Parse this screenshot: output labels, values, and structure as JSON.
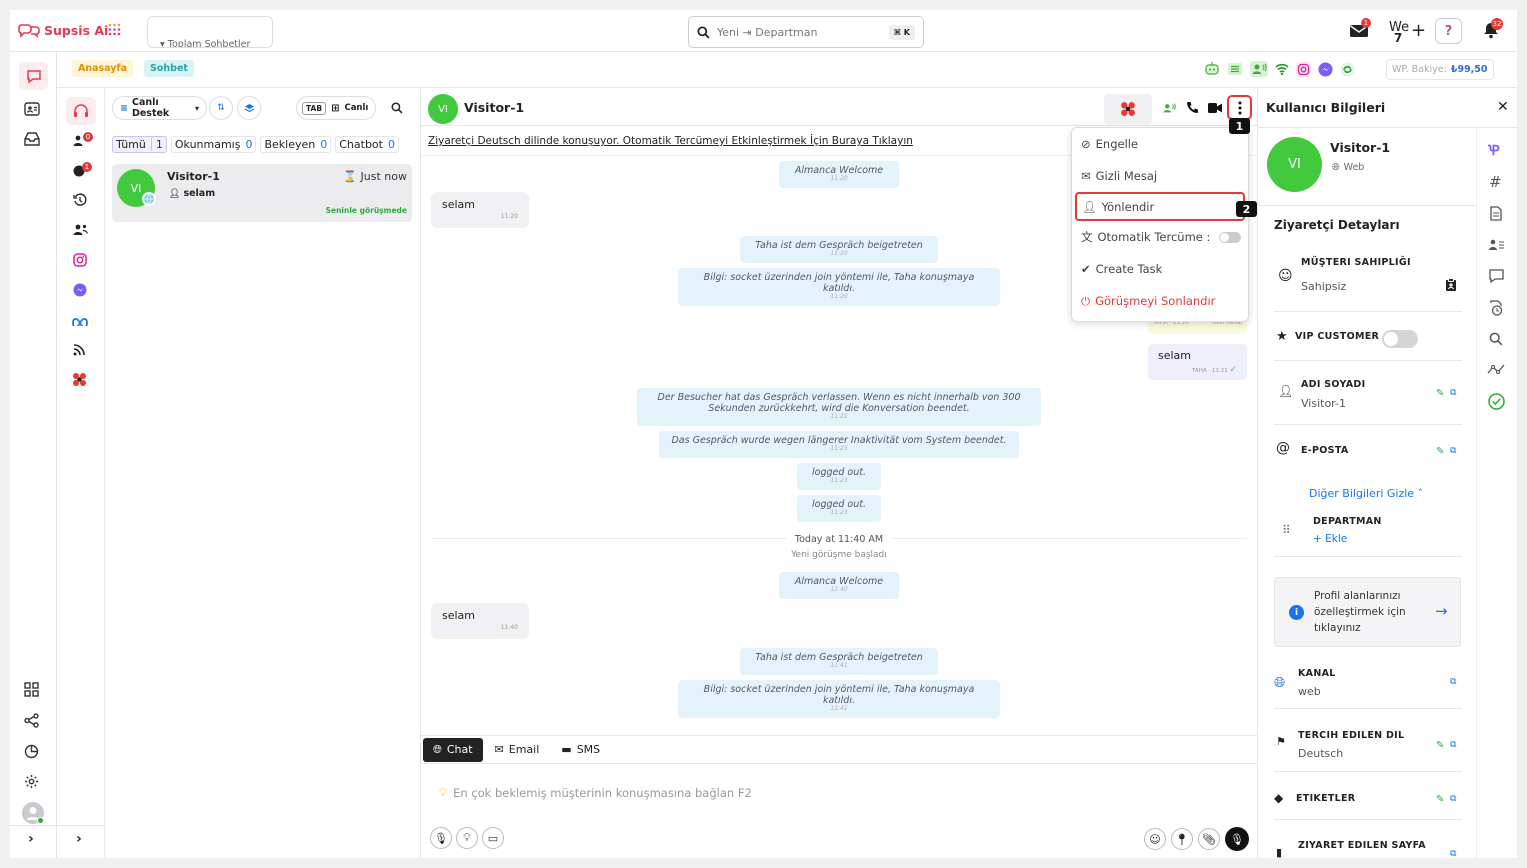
{
  "app": {
    "name": "Supsis Ai"
  },
  "top": {
    "tab_label": "Toplam Sohbetler",
    "search_placeholder": "Yeni ⇥ Departman",
    "search_shortcut": "⌘ K",
    "mail_badge": "1",
    "user_short": "We",
    "user_count": "7",
    "notif_badge": "32"
  },
  "subbar": {
    "tabs": [
      "Anasayfa",
      "Sohbet"
    ],
    "wp_label": "WP. Bakiye:",
    "wp_value": "₺99,50"
  },
  "convlist": {
    "dept_button": "Canlı Destek",
    "tab_key": "TAB",
    "live_label": "Canlı",
    "filters": [
      {
        "label": "Tümü",
        "count": "1"
      },
      {
        "label": "Okunmamış",
        "count": "0"
      },
      {
        "label": "Bekleyen",
        "count": "0"
      },
      {
        "label": "Chatbot",
        "count": "0"
      }
    ],
    "item": {
      "avatar": "VI",
      "name": "Visitor-1",
      "time": "Just now",
      "preview": "selam",
      "status": "Seninle görüşmede"
    }
  },
  "rail2": {
    "badge1": "0",
    "badge2": "1"
  },
  "chat": {
    "avatar": "VI",
    "title": "Visitor-1",
    "translate_banner": "Ziyaretçi Deutsch dilinde konuşuyor. Otomatik Tercümeyi Etkinleştirmek İçin Buraya Tıklayın",
    "step1": "1",
    "step2": "2",
    "messages": {
      "m1": {
        "text": "Almanca Welcome",
        "ts": "11:20"
      },
      "m2": {
        "text": "selam",
        "ts": "11:20"
      },
      "m3": {
        "text": "Taha ist dem Gespräch beigetreten",
        "ts": "11:20"
      },
      "m4": {
        "text": "Bilgi: socket üzerinden join yöntemi ile, Taha konuşmaya katıldı.",
        "ts": "11:20"
      },
      "m5": {
        "meta": "TAHA · 11:20",
        "tag": "Özel Mesaj"
      },
      "m6": {
        "text": "selam",
        "meta": "TAHA · 11:21"
      },
      "m7": {
        "text": "Der Besucher hat das Gespräch verlassen. Wenn es nicht innerhalb von 300 Sekunden zurückkehrt, wird die Konversation beendet.",
        "ts": "11:21"
      },
      "m8": {
        "text": "Das Gespräch wurde wegen längerer Inaktivität vom System beendet.",
        "ts": "11:23"
      },
      "m9": {
        "text": "logged out.",
        "ts": "11:23"
      },
      "m10": {
        "text": "logged out.",
        "ts": "11:23"
      },
      "day": "Today at 11:40 AM",
      "new": "Yeni görüşme başladı",
      "m11": {
        "text": "Almanca Welcome",
        "ts": "11:40"
      },
      "m12": {
        "text": "selam",
        "ts": "11:40"
      },
      "m13": {
        "text": "Taha ist dem Gespräch beigetreten",
        "ts": "11:41"
      },
      "m14": {
        "text": "Bilgi: socket üzerinden join yöntemi ile, Taha konuşmaya katıldı.",
        "ts": "11:41"
      }
    },
    "compose_tabs": [
      "Chat",
      "Email",
      "SMS"
    ],
    "compose_placeholder": "En çok beklemiş müşterinin konuşmasına bağlan F2",
    "menu": [
      "Engelle",
      "Gizli Mesaj",
      "Yönlendir",
      "Otomatik Tercüme :",
      "Create Task",
      "Görüşmeyi Sonlandır"
    ]
  },
  "right": {
    "title": "Kullanıcı Bilgileri",
    "avatar": "VI",
    "name": "Visitor-1",
    "source": "Web",
    "section": "Ziyaretçi Detayları",
    "owner_label": "MÜŞTERI SAHIPLIĞI",
    "owner_value": "Sahipsiz",
    "vip_label": "VIP CUSTOMER",
    "name_label": "ADI SOYADI",
    "name_value": "Visitor-1",
    "email_label": "E-POSTA",
    "more_toggle": "Diğer Bilgileri Gizle",
    "dept_label": "DEPARTMAN",
    "dept_add": "+ Ekle",
    "profile_card": "Profil alanlarınızı özelleştirmek için tıklayınız",
    "channel_label": "KANAL",
    "channel_value": "web",
    "lang_label": "TERCIH EDILEN DIL",
    "lang_value": "Deutsch",
    "tags_label": "ETIKETLER",
    "page_label": "ZIYARET EDILEN SAYFA"
  },
  "colors": {
    "brand": "#e53955",
    "accent_blue": "#1a73e8",
    "green": "#43c93e",
    "status_green": "#2eaa3c"
  }
}
